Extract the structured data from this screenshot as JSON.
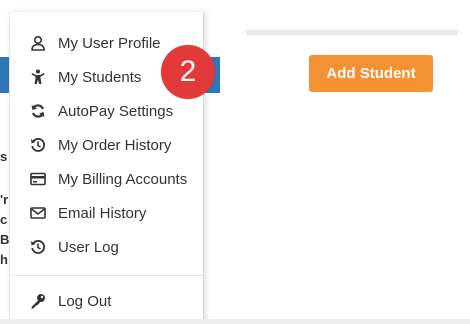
{
  "menu": {
    "items": [
      {
        "label": "My User Profile",
        "icon": "user-icon"
      },
      {
        "label": "My Students",
        "icon": "student-icon"
      },
      {
        "label": "AutoPay Settings",
        "icon": "sync-icon"
      },
      {
        "label": "My Order History",
        "icon": "history-icon"
      },
      {
        "label": "My Billing Accounts",
        "icon": "credit-card-icon"
      },
      {
        "label": "Email History",
        "icon": "envelope-icon"
      },
      {
        "label": "User Log",
        "icon": "history-icon"
      }
    ],
    "logout": {
      "label": "Log Out",
      "icon": "key-icon"
    }
  },
  "badge": {
    "number": "2",
    "color": "#e23a3a"
  },
  "add_student": {
    "label": "Add Student",
    "color": "#f49132"
  },
  "background": {
    "fragments": [
      "s",
      "'r",
      "c",
      "B",
      "h"
    ],
    "header_color": "#2f78b7"
  }
}
